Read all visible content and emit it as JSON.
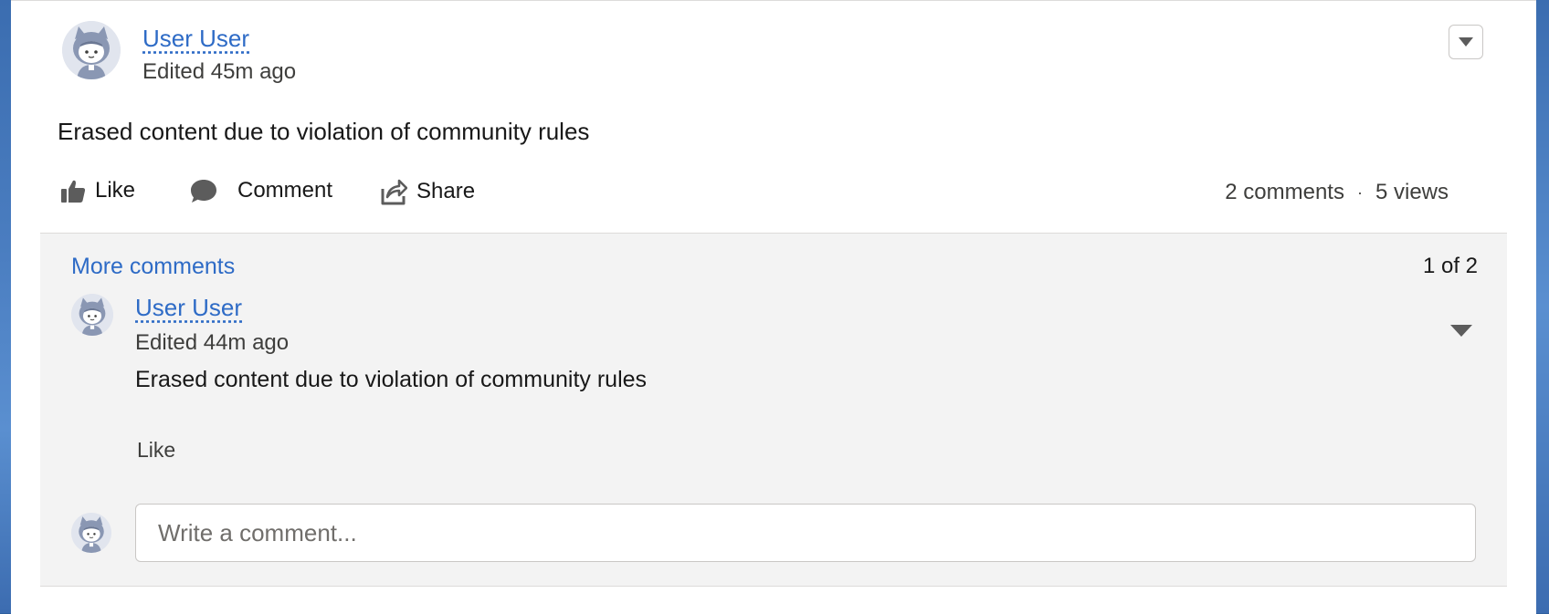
{
  "post": {
    "author": "User User",
    "edited": "Edited 45m ago",
    "body": "Erased content due to violation of community rules",
    "actions": {
      "like": "Like",
      "comment": "Comment",
      "share": "Share"
    },
    "stats": {
      "comments": "2 comments",
      "separator": "·",
      "views": "5 views"
    }
  },
  "comments_section": {
    "more_link": "More comments",
    "count": "1 of 2",
    "items": [
      {
        "author": "User User",
        "edited": "Edited 44m ago",
        "body": "Erased content due to violation of community rules",
        "like": "Like"
      }
    ],
    "input_placeholder": "Write a comment..."
  },
  "colors": {
    "link": "#2e6bc6",
    "comments_bg": "#f3f3f3",
    "icon": "#5c5c5c"
  },
  "icons": [
    "avatar",
    "thumbs-up-icon",
    "chat-bubble-icon",
    "share-icon",
    "chevron-down-icon",
    "caret-down-icon"
  ]
}
